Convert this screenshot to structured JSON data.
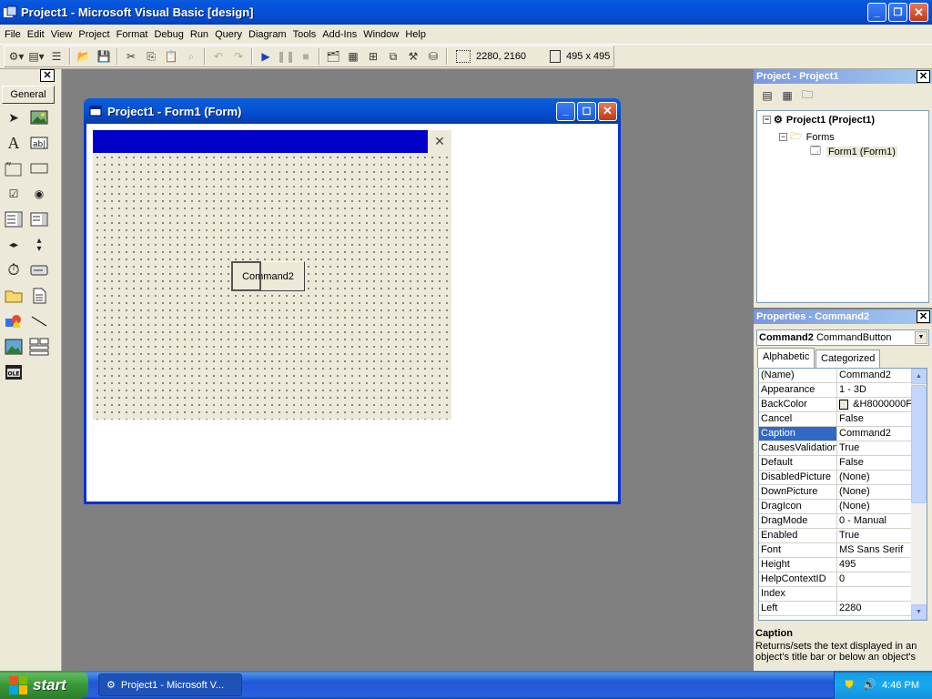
{
  "app": {
    "title": "Project1 - Microsoft Visual Basic [design]"
  },
  "menu": [
    "File",
    "Edit",
    "View",
    "Project",
    "Format",
    "Debug",
    "Run",
    "Query",
    "Diagram",
    "Tools",
    "Add-Ins",
    "Window",
    "Help"
  ],
  "toolbar": {
    "position_readout": "2280, 2160",
    "size_readout": "495 x 495"
  },
  "toolbox": {
    "tab_label": "General",
    "tools": [
      "pointer-icon",
      "picturebox-icon",
      "label-icon",
      "textbox-icon",
      "frame-icon",
      "commandbutton-icon",
      "checkbox-icon",
      "optionbutton-icon",
      "combobox-icon",
      "listbox-icon",
      "hscrollbar-icon",
      "vscrollbar-icon",
      "timer-icon",
      "drivelistbox-icon",
      "dirlistbox-icon",
      "filelistbox-icon",
      "shape-icon",
      "line-icon",
      "image-icon",
      "data-icon",
      "ole-icon"
    ]
  },
  "form_window": {
    "title": "Project1 - Form1 (Form)",
    "command_button": "Command2"
  },
  "project": {
    "title": "Project - Project1",
    "tree": {
      "root": "Project1 (Project1)",
      "folder": "Forms",
      "item": "Form1 (Form1)"
    }
  },
  "properties": {
    "title": "Properties - Command2",
    "object_name": "Command2",
    "object_type": "CommandButton",
    "tab_alphabetic": "Alphabetic",
    "tab_categorized": "Categorized",
    "rows": [
      {
        "name": "(Name)",
        "value": "Command2"
      },
      {
        "name": "Appearance",
        "value": "1 - 3D"
      },
      {
        "name": "BackColor",
        "value": "&H8000000F"
      },
      {
        "name": "Cancel",
        "value": "False"
      },
      {
        "name": "Caption",
        "value": "Command2"
      },
      {
        "name": "CausesValidation",
        "value": "True"
      },
      {
        "name": "Default",
        "value": "False"
      },
      {
        "name": "DisabledPicture",
        "value": "(None)"
      },
      {
        "name": "DownPicture",
        "value": "(None)"
      },
      {
        "name": "DragIcon",
        "value": "(None)"
      },
      {
        "name": "DragMode",
        "value": "0 - Manual"
      },
      {
        "name": "Enabled",
        "value": "True"
      },
      {
        "name": "Font",
        "value": "MS Sans Serif"
      },
      {
        "name": "Height",
        "value": "495"
      },
      {
        "name": "HelpContextID",
        "value": "0"
      },
      {
        "name": "Index",
        "value": ""
      },
      {
        "name": "Left",
        "value": "2280"
      }
    ],
    "selected": "Caption",
    "desc_title": "Caption",
    "desc_text": "Returns/sets the text displayed in an object's title bar or below an object's"
  },
  "taskbar": {
    "start": "start",
    "task": "Project1 - Microsoft V...",
    "clock": "4:46 PM"
  }
}
